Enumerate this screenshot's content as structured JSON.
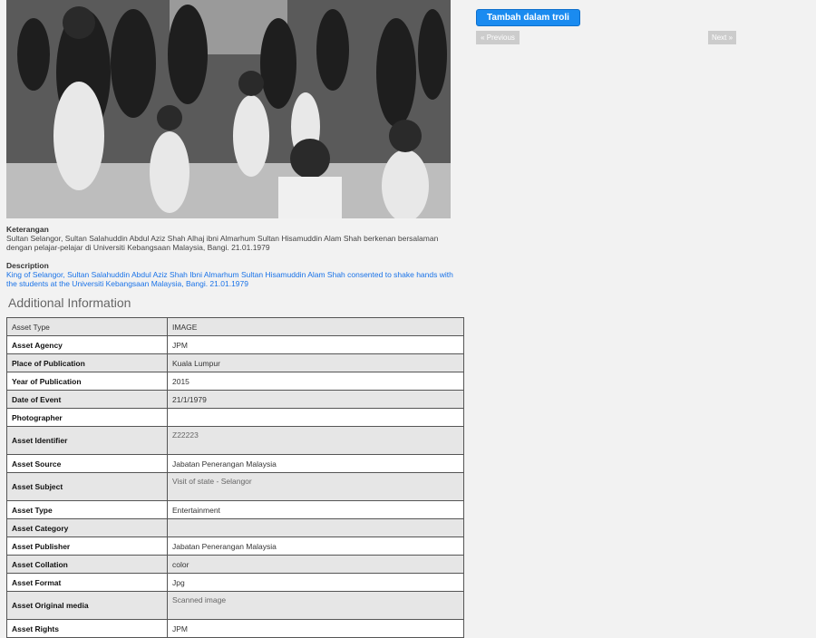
{
  "actions": {
    "add_to_cart": "Tambah dalam troli",
    "previous": "« Previous",
    "next": "Next »"
  },
  "photo": {
    "icon": "photo-image"
  },
  "keterangan": {
    "label": "Keterangan",
    "text": "Sultan Selangor, Sultan Salahuddin Abdul Aziz Shah Alhaj ibni Almarhum Sultan Hisamuddin Alam Shah berkenan bersalaman dengan pelajar-pelajar di Universiti Kebangsaan Malaysia, Bangi. 21.01.1979"
  },
  "description": {
    "label": "Description",
    "text": "King of Selangor, Sultan Salahuddin Abdul Aziz Shah Ibni Almarhum Sultan Hisamuddin Alam Shah consented to shake hands with the students at the Universiti Kebangsaan Malaysia, Bangi. 21.01.1979"
  },
  "additional_info": {
    "title": "Additional Information",
    "rows": [
      {
        "key": "Asset Type",
        "value": "IMAGE"
      },
      {
        "key": "Asset Agency",
        "value": "JPM"
      },
      {
        "key": "Place of Publication",
        "value": "Kuala Lumpur"
      },
      {
        "key": "Year of Publication",
        "value": "2015"
      },
      {
        "key": "Date of Event",
        "value": "21/1/1979"
      },
      {
        "key": "Photographer",
        "value": ""
      },
      {
        "key": "Asset Identifier",
        "value": "Z22223"
      },
      {
        "key": "Asset Source",
        "value": "Jabatan Penerangan Malaysia"
      },
      {
        "key": "Asset Subject",
        "value": "Visit of state - Selangor"
      },
      {
        "key": "Asset Type",
        "value": "Entertainment"
      },
      {
        "key": "Asset Category",
        "value": ""
      },
      {
        "key": "Asset Publisher",
        "value": "Jabatan Penerangan Malaysia"
      },
      {
        "key": "Asset Collation",
        "value": "color"
      },
      {
        "key": "Asset Format",
        "value": "Jpg"
      },
      {
        "key": "Asset Original media",
        "value": "Scanned image"
      },
      {
        "key": "Asset Rights",
        "value": "JPM"
      }
    ]
  },
  "colors": {
    "button_blue": "#1a8bf0",
    "link_blue": "#1a73e8",
    "pager_gray": "#cccccc"
  }
}
